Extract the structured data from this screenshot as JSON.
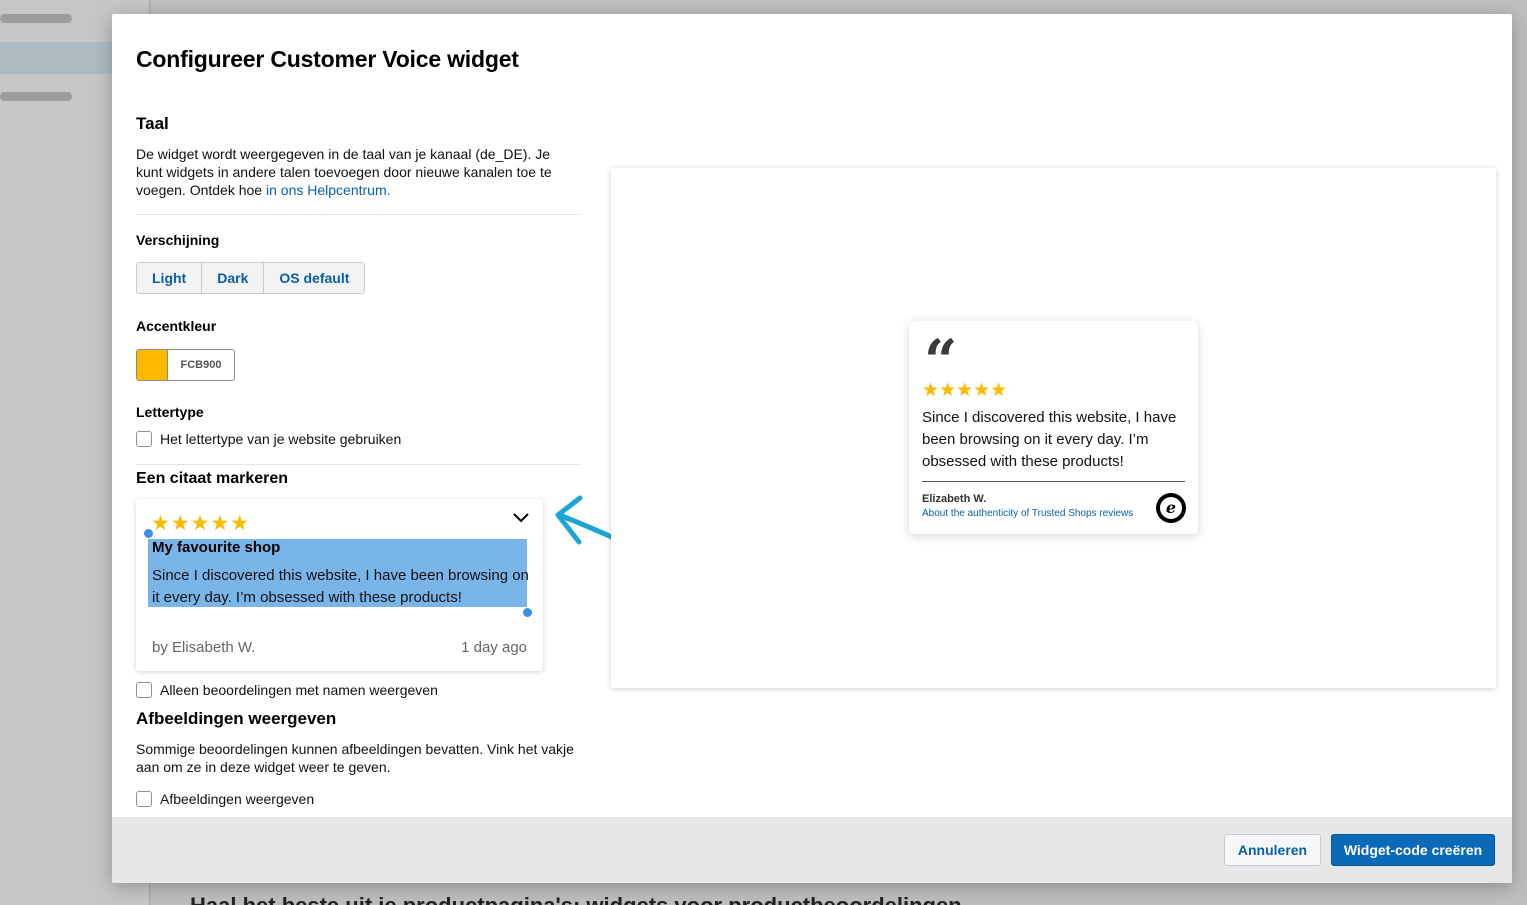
{
  "background": {
    "heading": "Haal het beste uit je productpagina's: widgets voor productbeoordelingen"
  },
  "modal": {
    "title": "Configureer Customer Voice widget",
    "language": {
      "heading": "Taal",
      "text": "De widget wordt weergegeven in de taal van je kanaal (de_DE). Je kunt widgets in andere talen toevoegen door nieuwe kanalen toe te voegen. Ontdek hoe ",
      "link": "in ons Helpcentrum."
    },
    "appearance": {
      "label": "Verschijning",
      "options": [
        "Light",
        "Dark",
        "OS default"
      ]
    },
    "accent": {
      "label": "Accentkleur",
      "hex": "FCB900",
      "color": "#FCB900"
    },
    "font": {
      "label": "Lettertype",
      "checkbox": "Het lettertype van je website gebruiken"
    },
    "quote": {
      "heading": "Een citaat markeren",
      "stars": "★★★★★",
      "review_title": "My favourite shop",
      "review_text": "Since I discovered this website, I have been browsing on it every day. I’m obsessed with these products!",
      "author": "by Elisabeth W.",
      "date": "1 day ago",
      "names_only_checkbox": "Alleen beoordelingen met namen weergeven"
    },
    "images": {
      "heading": "Afbeeldingen weergeven",
      "text": "Sommige beoordelingen kunnen afbeeldingen bevatten. Vink het vakje aan om ze in deze widget weer te geven.",
      "checkbox": "Afbeeldingen weergeven"
    },
    "preview": {
      "quote_mark": "“",
      "stars": "★★★★★",
      "text": "Since I discovered this website, I have been browsing on it every day. I’m obsessed with these products!",
      "author": "Elizabeth W.",
      "link": "About the authenticity of Trusted Shops reviews",
      "logo_letter": "e"
    },
    "footer": {
      "cancel": "Annuleren",
      "submit": "Widget-code creëren"
    }
  }
}
